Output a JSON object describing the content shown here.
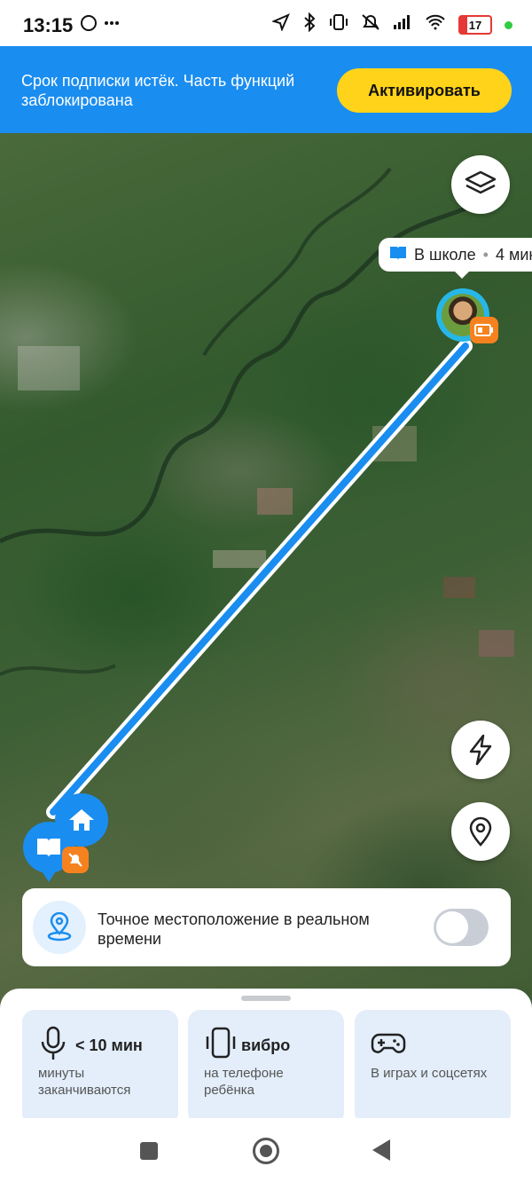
{
  "status_bar": {
    "time": "13:15",
    "battery": "17",
    "icons": [
      "whatsapp-icon",
      "more-dots-icon",
      "location-arrow-icon",
      "bluetooth-icon",
      "vibrate-icon",
      "muted-icon",
      "signal-icon",
      "wifi-icon",
      "battery-icon"
    ]
  },
  "banner": {
    "message": "Срок подписки истёк. Часть функций заблокирована",
    "activate_label": "Активировать",
    "background": "#1a8df0",
    "button_color": "#ffd31a"
  },
  "map": {
    "tooltip": {
      "place": "В школе",
      "separator": "•",
      "duration": "4 мин"
    },
    "route_color": "#1a8df0"
  },
  "realtime": {
    "label": "Точное местоположение в реальном времени",
    "enabled": false
  },
  "features": [
    {
      "value": "< 10 мин",
      "desc": "минуты заканчиваются",
      "icon": "microphone-icon"
    },
    {
      "value": "вибро",
      "desc": "на телефоне ребёнка",
      "icon": "phone-vibrate-icon"
    },
    {
      "value": "",
      "desc": "В играх и соцсетях",
      "icon": "gamepad-icon"
    }
  ]
}
